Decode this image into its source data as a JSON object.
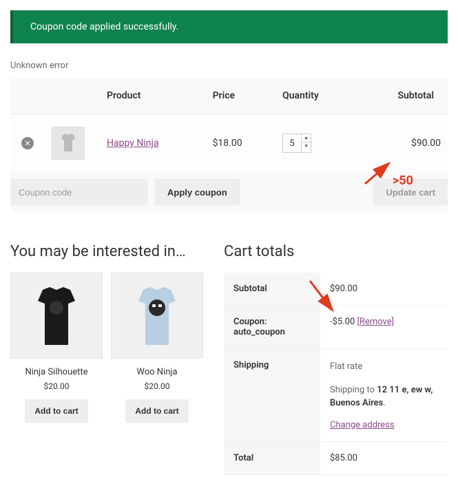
{
  "notice": "Coupon code applied successfully.",
  "error": "Unknown error",
  "cart": {
    "headers": {
      "product": "Product",
      "price": "Price",
      "quantity": "Quantity",
      "subtotal": "Subtotal"
    },
    "items": [
      {
        "name": "Happy Ninja",
        "price": "$18.00",
        "qty": "5",
        "subtotal": "$90.00"
      }
    ],
    "coupon_placeholder": "Coupon code",
    "apply_label": "Apply coupon",
    "update_label": "Update cart"
  },
  "annotation": {
    "subtotal_note": ">50"
  },
  "interest": {
    "title": "You may be interested in…",
    "products": [
      {
        "name": "Ninja Silhouette",
        "price": "$20.00",
        "add_label": "Add to cart"
      },
      {
        "name": "Woo Ninja",
        "price": "$20.00",
        "add_label": "Add to cart"
      }
    ]
  },
  "totals": {
    "title": "Cart totals",
    "rows": {
      "subtotal_label": "Subtotal",
      "subtotal_value": "$90.00",
      "coupon_label": "Coupon: auto_coupon",
      "coupon_value": "-$5.00",
      "coupon_remove": "[Remove]",
      "shipping_label": "Shipping",
      "shipping_method": "Flat rate",
      "shipping_to_prefix": "Shipping to ",
      "shipping_address": "12 11 e, ew w, Buenos Aires",
      "change_address": "Change address",
      "total_label": "Total",
      "total_value": "$85.00"
    }
  }
}
